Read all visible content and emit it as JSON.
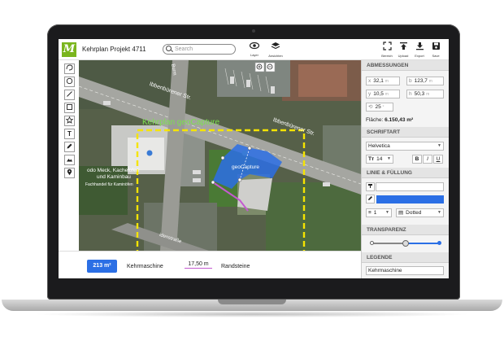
{
  "app": {
    "logo_letter": "M",
    "project_title": "Kehrplan Projekt 4711"
  },
  "search": {
    "placeholder": "Search"
  },
  "toolbar": {
    "layer_label": "Layer",
    "ansichten_label": "Ansichten",
    "bereich_label": "Bereich",
    "upload_label": "Upload",
    "export_label": "Export",
    "save_label": "Save"
  },
  "map": {
    "selection_label": "Kehrplan geoCapture",
    "pin_label": "geoCapture",
    "business_line1": "odo Meck, Kachelofen",
    "business_line2": "und Kaminbau",
    "business_line3": "Fachhandel für Kaminöfen",
    "street1": "Ibbenbürener Str.",
    "street2": "Ibbenbürener Str.",
    "street3": "Burm",
    "street4": "idenstraße",
    "accent_yellow": "#f5e400",
    "accent_blue": "#2b6fe5",
    "accent_purple": "#c45ad0"
  },
  "bottom": {
    "area_value": "213 m²",
    "area_label": "Kehrmaschine",
    "length_value": "17,50 m",
    "length_label": "Randsteine"
  },
  "panel": {
    "dimensions_title": "ABMESSUNGEN",
    "x_label": "x",
    "x_value": "32,1",
    "b_label": "b",
    "b_value": "123,7",
    "y_label": "y",
    "y_value": "10,5",
    "h_label": "h",
    "h_value": "50,3",
    "angle_value": "25",
    "unit_m": "m",
    "unit_deg": "°",
    "area_label": "Fläche:",
    "area_value": "6.150,43 m²",
    "font_title": "SCHRIFTART",
    "font_name": "Helvetica",
    "font_size": "14",
    "bold": "B",
    "italic": "I",
    "underline": "U",
    "line_title": "LINIE & FÜLLUNG",
    "line_width": "1",
    "line_style": "Dotted",
    "transparency_title": "TRANSPARENZ",
    "transparency_value": 0.5,
    "legend_title": "LEGENDE",
    "legend_value": "Kehrmaschine"
  }
}
